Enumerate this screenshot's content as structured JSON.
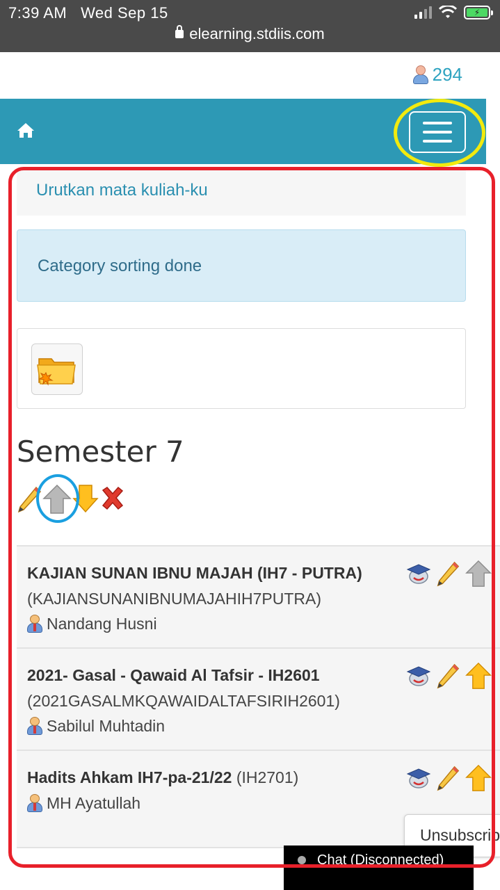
{
  "status_bar": {
    "time": "7:39 AM",
    "date": "Wed Sep 15",
    "url": "elearning.stdiis.com"
  },
  "header": {
    "user_count": "294"
  },
  "sort_link": "Urutkan mata kuliah-ku",
  "alert": "Category sorting done",
  "category": {
    "title": "Semester 7"
  },
  "courses": [
    {
      "name": "KAJIAN SUNAN IBNU MAJAH (IH7 - PUTRA)",
      "shortname": "(KAJIANSUNANIBNUMAJAHIH7PUTRA)",
      "teacher": "Nandang Husni"
    },
    {
      "name": "2021- Gasal - Qawaid Al Tafsir - IH2601",
      "shortname": "(2021GASALMKQAWAIDALTAFSIRIH2601)",
      "teacher": "Sabilul Muhtadin"
    },
    {
      "name": "Hadits Ahkam IH7-pa-21/22",
      "shortname": "(IH2701)",
      "teacher": "MH Ayatullah"
    }
  ],
  "unsubscribe_label": "Unsubscribe",
  "chat_label": "Chat (Disconnected)",
  "colors": {
    "navbar": "#2d99b5",
    "link": "#2a8fb0",
    "alert_bg": "#d9edf7",
    "highlight_red": "#e8202a",
    "highlight_yellow": "#f2ea0e",
    "highlight_blue": "#1a9fe0"
  },
  "icons": [
    "home-icon",
    "hamburger-menu-icon",
    "user-icon",
    "folder-icon",
    "edit-icon",
    "move-up-icon",
    "move-down-icon",
    "delete-icon",
    "enrol-icon"
  ]
}
